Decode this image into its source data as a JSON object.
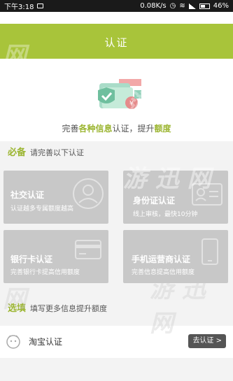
{
  "status_bar": {
    "time": "下午3:18",
    "network_speed": "0.08K/s",
    "battery": "46%"
  },
  "header": {
    "title": "认证",
    "subtitle_parts": [
      "完善",
      "各种信息",
      "认证，提升",
      "额度"
    ]
  },
  "required_section": {
    "key": "必备",
    "desc": "请完善以下认证"
  },
  "cards": [
    {
      "title": "社交认证",
      "subtitle": "认证越多专属额度越高"
    },
    {
      "title": "身份证认证",
      "subtitle": "线上审核，最快10分钟"
    },
    {
      "title": "银行卡认证",
      "subtitle": "完善银行卡提高信用额度"
    },
    {
      "title": "手机运营商认证",
      "subtitle": "完善信息提高信用额度"
    }
  ],
  "optional_section": {
    "key": "选填",
    "desc": "填写更多信息提升额度"
  },
  "optional_items": [
    {
      "label": "淘宝认证",
      "action": "去认证 >"
    }
  ],
  "watermarks": [
    "网",
    "游 迅 网"
  ],
  "colors": {
    "accent": "#a8c43a",
    "card": "#c8c8c8"
  }
}
